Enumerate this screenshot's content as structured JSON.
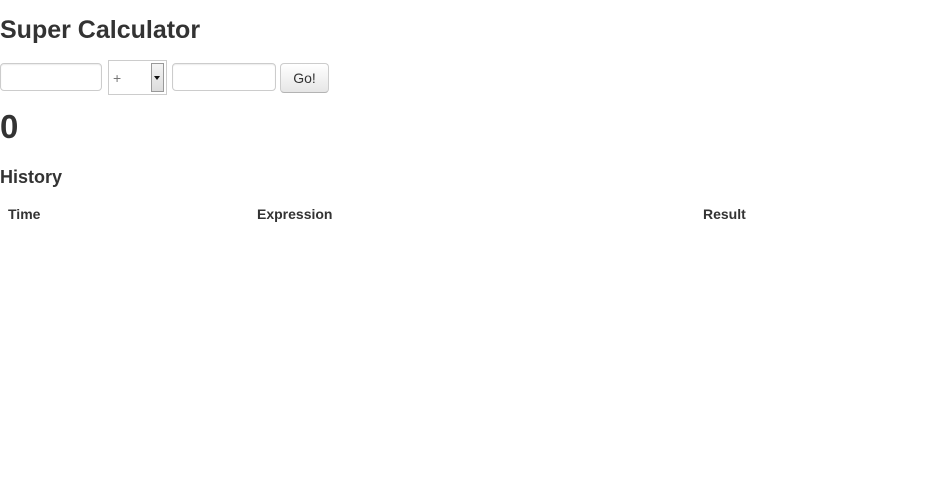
{
  "app": {
    "title": "Super Calculator"
  },
  "form": {
    "first_operand": {
      "value": "",
      "placeholder": ""
    },
    "operator": {
      "selected": "+",
      "options": [
        "+"
      ]
    },
    "second_operand": {
      "value": "",
      "placeholder": ""
    },
    "submit_label": "Go!"
  },
  "result": {
    "value": "0"
  },
  "history": {
    "title": "History",
    "columns": [
      "Time",
      "Expression",
      "Result"
    ],
    "rows": []
  }
}
